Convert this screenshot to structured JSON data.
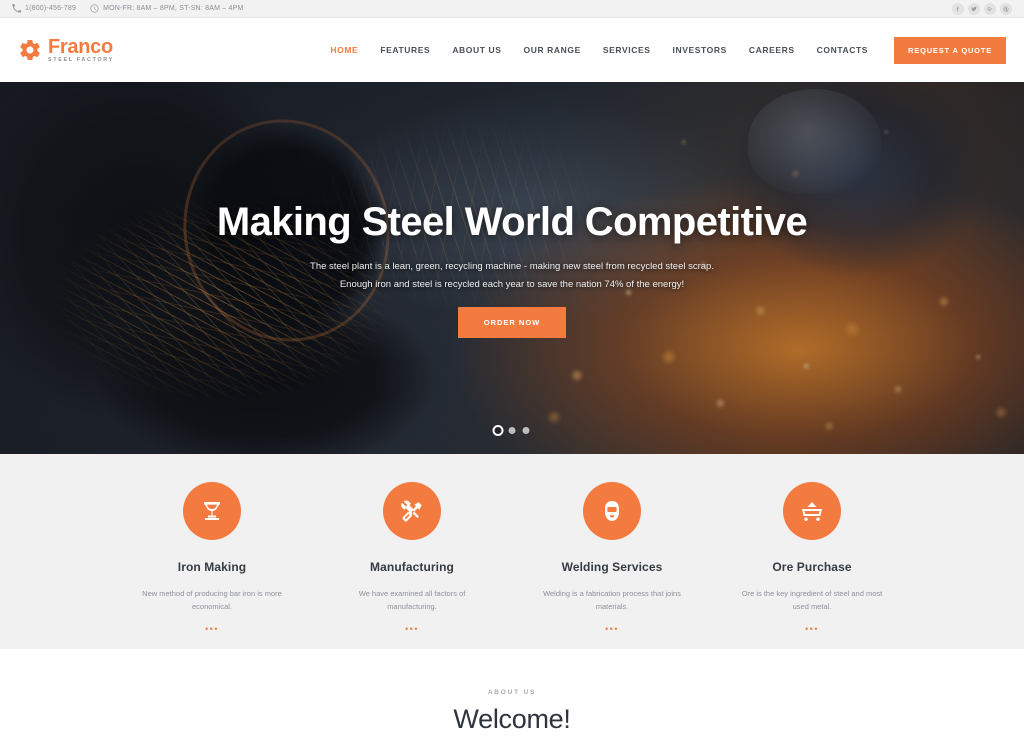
{
  "topbar": {
    "phone": {
      "icon": "phone-icon",
      "text": "1(800)-456-789"
    },
    "hours": {
      "icon": "clock-icon",
      "text": "MON-FR: 8AM – 8PM, ST-SN: 8AM – 4PM"
    },
    "social": [
      {
        "name": "facebook-icon",
        "glyph": "f"
      },
      {
        "name": "twitter-icon",
        "glyph": "t"
      },
      {
        "name": "google-plus-icon",
        "glyph": "g"
      },
      {
        "name": "pinterest-icon",
        "glyph": "p"
      }
    ]
  },
  "header": {
    "logo": {
      "icon": "gear-icon",
      "title": "Franco",
      "subtitle": "STEEL FACTORY"
    },
    "nav": [
      {
        "label": "HOME",
        "active": true
      },
      {
        "label": "FEATURES",
        "active": false
      },
      {
        "label": "ABOUT US",
        "active": false
      },
      {
        "label": "OUR RANGE",
        "active": false
      },
      {
        "label": "SERVICES",
        "active": false
      },
      {
        "label": "INVESTORS",
        "active": false
      },
      {
        "label": "CAREERS",
        "active": false
      },
      {
        "label": "CONTACTS",
        "active": false
      }
    ],
    "quote_button": "REQUEST A QUOTE"
  },
  "hero": {
    "title": "Making Steel World Competitive",
    "line1": "The steel plant is a lean, green, recycling machine - making new steel from recycled steel scrap.",
    "line2": "Enough iron and steel is recycled each year to save the nation 74% of the energy!",
    "cta": "ORDER NOW",
    "slides": 3,
    "active_slide": 1
  },
  "services": [
    {
      "icon": "crucible-icon",
      "title": "Iron Making",
      "desc": "New method of producing bar iron is more economical.",
      "dots": "•••"
    },
    {
      "icon": "hammer-wrench-icon",
      "title": "Manufacturing",
      "desc": "We have examined all factors of manufacturing.",
      "dots": "•••"
    },
    {
      "icon": "welding-mask-icon",
      "title": "Welding Services",
      "desc": "Welding is a fabrication process that joins materials.",
      "dots": "•••"
    },
    {
      "icon": "ore-cart-icon",
      "title": "Ore Purchase",
      "desc": "Ore is the key ingredient of steel and most used metal.",
      "dots": "•••"
    }
  ],
  "about": {
    "label": "ABOUT US",
    "title": "Welcome!"
  },
  "colors": {
    "accent": "#f47b40",
    "topbar_bg": "#f2f2f2",
    "services_bg": "#f1f1f1",
    "heading": "#2f343c",
    "body_text": "#8d9199"
  }
}
